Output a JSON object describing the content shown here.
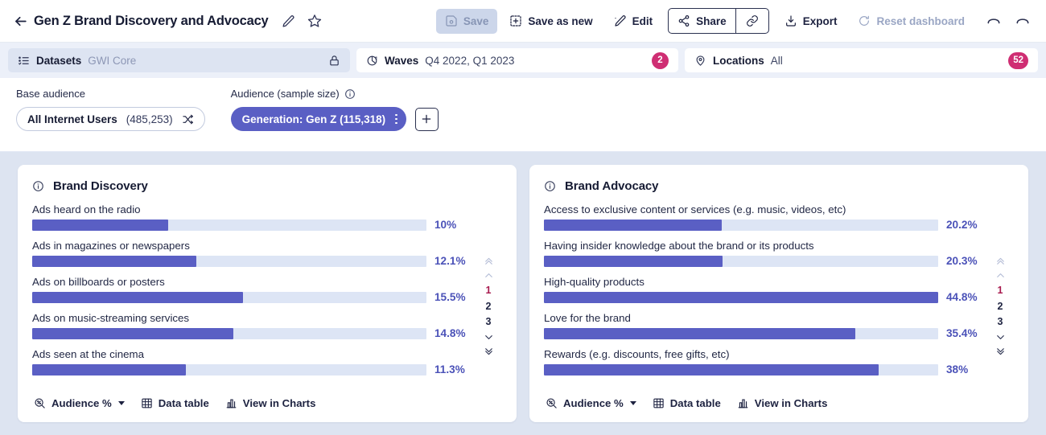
{
  "titlebar": {
    "back_icon": "arrow-left-icon",
    "title": "Gen Z Brand Discovery and Advocacy",
    "edit_title_icon": "pencil-icon",
    "favorite_icon": "star-icon",
    "buttons": [
      {
        "label": "Save",
        "icon": "save-disk-icon",
        "state": "disabled"
      },
      {
        "label": "Save as new",
        "icon": "save-as-new-icon",
        "state": "enabled"
      },
      {
        "label": "Edit",
        "icon": "edit-pencil-icon",
        "state": "enabled"
      },
      {
        "label": "Share",
        "icon": "share-nodes-icon",
        "state": "enabled"
      },
      {
        "label": "Export",
        "icon": "export-download-icon",
        "state": "enabled"
      },
      {
        "label": "Reset dashboard",
        "icon": "reset-circle-icon",
        "state": "disabled"
      }
    ],
    "link_icon": "link-chain-icon",
    "undo_icon": "undo-arrow-icon",
    "redo_icon": "redo-arrow-icon"
  },
  "filterbar": {
    "datasets": {
      "label": "Datasets",
      "value": "GWI Core",
      "icon": "list-check-icon",
      "lock_icon": "lock-icon"
    },
    "waves": {
      "label": "Waves",
      "value": "Q4 2022, Q1 2023",
      "icon": "wave-chart-icon",
      "badge": "2"
    },
    "locations": {
      "label": "Locations",
      "value": "All",
      "icon": "location-pin-icon",
      "badge": "52"
    },
    "badge_color": "#cf2e73"
  },
  "audience": {
    "base_label": "Base audience",
    "base_name": "All Internet Users",
    "base_count": "(485,253)",
    "base_swap_icon": "shuffle-icon",
    "audience_label": "Audience (sample size)",
    "audience_info_icon": "info-icon",
    "audience_pill": "Generation: Gen Z (115,318)",
    "audience_menu_icon": "kebab-menu-icon",
    "add_icon": "plus-icon",
    "pill_color": "#5a5fc4"
  },
  "chart_data": [
    {
      "type": "bar",
      "title": "Brand Discovery",
      "orientation": "horizontal",
      "info_icon": "info-icon",
      "xlabel": "",
      "ylabel": "",
      "metric": "Audience %",
      "categories": [
        "Ads heard on the radio",
        "Ads in magazines or newspapers",
        "Ads on billboards or posters",
        "Ads on music-streaming services",
        "Ads seen at the cinema"
      ],
      "values": [
        10,
        12.1,
        15.5,
        14.8,
        11.3
      ],
      "value_labels": [
        "10%",
        "12.1%",
        "15.5%",
        "14.8%",
        "11.3%"
      ],
      "bar_color": "#5a5fc4",
      "track_color": "#dde5f5",
      "xlim": [
        0,
        29
      ],
      "grid": false,
      "legend": "none"
    },
    {
      "type": "bar",
      "title": "Brand Advocacy",
      "orientation": "horizontal",
      "info_icon": "info-icon",
      "xlabel": "",
      "ylabel": "",
      "metric": "Audience %",
      "categories": [
        "Access to exclusive content or services (e.g. music, videos, etc)",
        "Having insider knowledge about the brand or its products",
        "High-quality products",
        "Love for the brand",
        "Rewards (e.g. discounts, free gifts, etc)"
      ],
      "values": [
        20.2,
        20.3,
        44.8,
        35.4,
        38
      ],
      "value_labels": [
        "20.2%",
        "20.3%",
        "44.8%",
        "35.4%",
        "38%"
      ],
      "bar_color": "#5a5fc4",
      "track_color": "#dde5f5",
      "xlim": [
        0,
        44.8
      ],
      "grid": false,
      "legend": "none"
    }
  ],
  "pager": {
    "first_icon": "chevrons-up-icon",
    "prev_icon": "chevron-up-icon",
    "pages": [
      "1",
      "2",
      "3"
    ],
    "current_page": "1",
    "next_icon": "chevron-down-icon",
    "last_icon": "chevrons-down-icon",
    "current_color": "#a81a4e"
  },
  "card_footer": {
    "metric_label": "Audience %",
    "metric_icon": "magnifier-percent-icon",
    "data_table_label": "Data table",
    "data_table_icon": "table-grid-icon",
    "view_charts_label": "View in Charts",
    "view_charts_icon": "bar-chart-icon"
  }
}
